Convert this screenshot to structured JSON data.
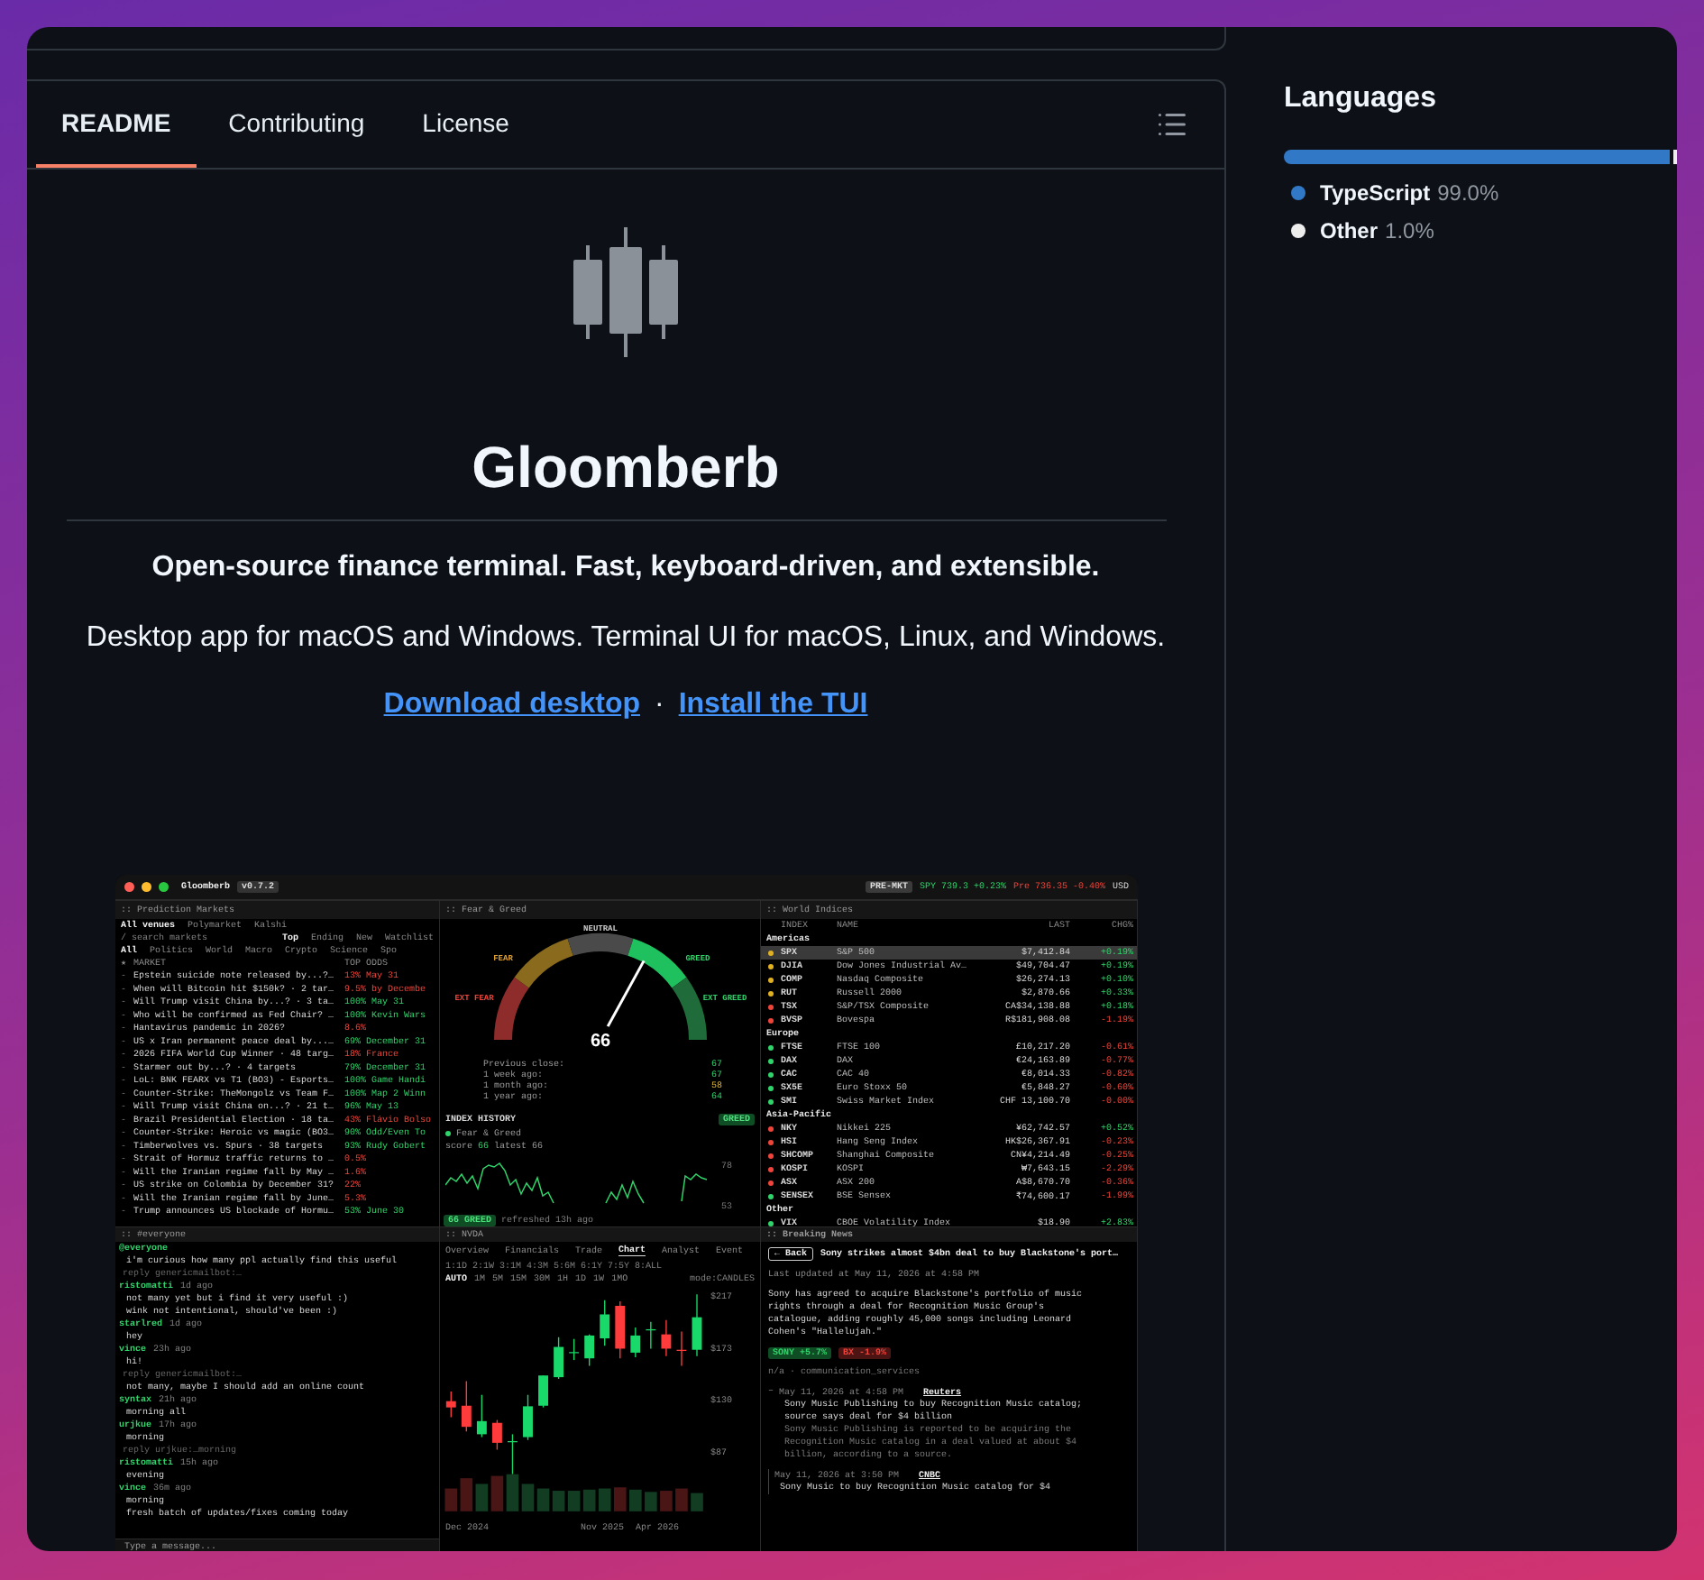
{
  "readme_tabs": [
    {
      "label": "README",
      "selected": true
    },
    {
      "label": "Contributing",
      "selected": false
    },
    {
      "label": "License",
      "selected": false
    }
  ],
  "readme": {
    "title": "Gloomberb",
    "tagline": "Open-source finance terminal. Fast, keyboard-driven, and extensible.",
    "description": "Desktop app for macOS and Windows. Terminal UI for macOS, Linux, and Windows.",
    "links": [
      "Download desktop",
      "Install the TUI"
    ],
    "link_separator": "·"
  },
  "app_screenshot": {
    "title": "Gloomberb",
    "version": "v0.7.2",
    "session": "PRE-MKT",
    "quotes": [
      {
        "text": "SPY 739.3 +0.23%",
        "rising": true
      },
      {
        "text": "Pre 736.35 -0.40%",
        "rising": false
      }
    ],
    "currency": "USD",
    "prediction_markets": {
      "title": ":: Prediction Markets",
      "venues": [
        {
          "label": "All venues",
          "selected": true
        },
        {
          "label": "Polymarket",
          "selected": false
        },
        {
          "label": "Kalshi",
          "selected": false
        }
      ],
      "search_placeholder": "/ search markets",
      "sorts": [
        {
          "label": "Top",
          "selected": true
        },
        {
          "label": "Ending",
          "selected": false
        },
        {
          "label": "New",
          "selected": false
        },
        {
          "label": "Watchlist",
          "selected": false
        }
      ],
      "categories": [
        {
          "label": "All",
          "selected": true
        },
        {
          "label": "Politics",
          "selected": false
        },
        {
          "label": "World",
          "selected": false
        },
        {
          "label": "Macro",
          "selected": false
        },
        {
          "label": "Crypto",
          "selected": false
        },
        {
          "label": "Science",
          "selected": false
        },
        {
          "label": "Spo",
          "selected": false
        }
      ],
      "columns": [
        "★",
        "MARKET",
        "TOP ODDS"
      ],
      "rows": [
        {
          "watch_mark": "-",
          "market": "Epstein suicide note released by...?…",
          "odds": "13% May 31",
          "rising": false
        },
        {
          "watch_mark": "-",
          "market": "When will Bitcoin hit $150k? · 2 tar…",
          "odds": "9.5% by Decembe",
          "rising": false
        },
        {
          "watch_mark": "-",
          "market": "Will Trump visit China by...? · 3 ta…",
          "odds": "100% May 31",
          "rising": true
        },
        {
          "watch_mark": "-",
          "market": "Who will be confirmed as Fed Chair? …",
          "odds": "100% Kevin Wars",
          "rising": true
        },
        {
          "watch_mark": "-",
          "market": "Hantavirus pandemic in 2026?",
          "odds": "8.6%",
          "rising": false
        },
        {
          "watch_mark": "-",
          "market": "US x Iran permanent peace deal by...…",
          "odds": "69% December 31",
          "rising": true
        },
        {
          "watch_mark": "-",
          "market": "2026 FIFA World Cup Winner · 48 targ…",
          "odds": "18% France",
          "rising": false
        },
        {
          "watch_mark": "-",
          "market": "Starmer out by...? · 4 targets",
          "odds": "79% December 31",
          "rising": true
        },
        {
          "watch_mark": "-",
          "market": "LoL: BNK FEARX vs T1 (BO3) - Esports…",
          "odds": "100% Game Handi",
          "rising": true
        },
        {
          "watch_mark": "-",
          "market": "Counter-Strike: TheMongolz vs Team F…",
          "odds": "100% Map 2 Winn",
          "rising": true
        },
        {
          "watch_mark": "-",
          "market": "Will Trump visit China on...? · 21 t…",
          "odds": "96% May 13",
          "rising": true
        },
        {
          "watch_mark": "-",
          "market": "Brazil Presidential Election · 18 ta…",
          "odds": "43% Flávio Bolso",
          "rising": false
        },
        {
          "watch_mark": "-",
          "market": "Counter-Strike: Heroic vs magic (BO3…",
          "odds": "90% Odd/Even To",
          "rising": true
        },
        {
          "watch_mark": "-",
          "market": "Timberwolves vs. Spurs · 38 targets",
          "odds": "93% Rudy Gobert",
          "rising": true
        },
        {
          "watch_mark": "-",
          "market": "Strait of Hormuz traffic returns to …",
          "odds": "0.5%",
          "rising": false
        },
        {
          "watch_mark": "-",
          "market": "Will the Iranian regime fall by May …",
          "odds": "1.6%",
          "rising": false
        },
        {
          "watch_mark": "-",
          "market": "US strike on Colombia by December 31?",
          "odds": "22%",
          "rising": false
        },
        {
          "watch_mark": "-",
          "market": "Will the Iranian regime fall by June…",
          "odds": "5.3%",
          "rising": false
        },
        {
          "watch_mark": "-",
          "market": "Trump announces US blockade of Hormu…",
          "odds": "53% June 30",
          "rising": true
        }
      ]
    },
    "fear_greed": {
      "title": ":: Fear & Greed",
      "zones": [
        "EXT FEAR",
        "FEAR",
        "NEUTRAL",
        "GREED",
        "EXT GREED"
      ],
      "score": "66",
      "stats": [
        {
          "label": "Previous close:",
          "value": "67",
          "kind": "greed"
        },
        {
          "label": "1 week ago:",
          "value": "67",
          "kind": "greed"
        },
        {
          "label": "1 month ago:",
          "value": "58",
          "kind": "neutral"
        },
        {
          "label": "1 year ago:",
          "value": "64",
          "kind": "greed"
        }
      ],
      "history_title": "INDEX HISTORY",
      "rating": "GREED",
      "legend": "Fear & Greed",
      "score_label": "score",
      "score_value": "66",
      "latest": "latest 66",
      "axis": [
        "78",
        "53"
      ],
      "status": "66 GREED",
      "refreshed": "refreshed 13h ago"
    },
    "world_indices": {
      "title": ":: World Indices",
      "columns": [
        "INDEX",
        "NAME",
        "LAST",
        "CHG%"
      ],
      "groups": [
        {
          "name": "Americas",
          "rows": [
            {
              "symbol": "SPX",
              "name": "S&P 500",
              "last": "$7,412.84",
              "change": "+0.19%",
              "rising": true,
              "color": "#e0b020",
              "selected": true
            },
            {
              "symbol": "DJIA",
              "name": "Dow Jones Industrial Av…",
              "last": "$49,704.47",
              "change": "+0.19%",
              "rising": true,
              "color": "#e0b020",
              "selected": false
            },
            {
              "symbol": "COMP",
              "name": "Nasdaq Composite",
              "last": "$26,274.13",
              "change": "+0.10%",
              "rising": true,
              "color": "#e0b020",
              "selected": false
            },
            {
              "symbol": "RUT",
              "name": "Russell 2000",
              "last": "$2,870.66",
              "change": "+0.33%",
              "rising": true,
              "color": "#e0b020",
              "selected": false
            },
            {
              "symbol": "TSX",
              "name": "S&P/TSX Composite",
              "last": "CA$34,138.88",
              "change": "+0.18%",
              "rising": true,
              "color": "#f0443a",
              "selected": false
            },
            {
              "symbol": "BVSP",
              "name": "Bovespa",
              "last": "R$181,908.08",
              "change": "-1.19%",
              "rising": false,
              "color": "#f0443a",
              "selected": false
            }
          ]
        },
        {
          "name": "Europe",
          "rows": [
            {
              "symbol": "FTSE",
              "name": "FTSE 100",
              "last": "£10,217.20",
              "change": "-0.61%",
              "rising": false,
              "color": "#2fd46a",
              "selected": false
            },
            {
              "symbol": "DAX",
              "name": "DAX",
              "last": "€24,163.89",
              "change": "-0.77%",
              "rising": false,
              "color": "#2fd46a",
              "selected": false
            },
            {
              "symbol": "CAC",
              "name": "CAC 40",
              "last": "€8,014.33",
              "change": "-0.82%",
              "rising": false,
              "color": "#2fd46a",
              "selected": false
            },
            {
              "symbol": "SX5E",
              "name": "Euro Stoxx 50",
              "last": "€5,848.27",
              "change": "-0.60%",
              "rising": false,
              "color": "#2fd46a",
              "selected": false
            },
            {
              "symbol": "SMI",
              "name": "Swiss Market Index",
              "last": "CHF 13,100.70",
              "change": "-0.00%",
              "rising": false,
              "color": "#2fd46a",
              "selected": false
            }
          ]
        },
        {
          "name": "Asia-Pacific",
          "rows": [
            {
              "symbol": "NKY",
              "name": "Nikkei 225",
              "last": "¥62,742.57",
              "change": "+0.52%",
              "rising": true,
              "color": "#f0443a",
              "selected": false
            },
            {
              "symbol": "HSI",
              "name": "Hang Seng Index",
              "last": "HK$26,367.91",
              "change": "-0.23%",
              "rising": false,
              "color": "#f0443a",
              "selected": false
            },
            {
              "symbol": "SHCOMP",
              "name": "Shanghai Composite",
              "last": "CN¥4,214.49",
              "change": "-0.25%",
              "rising": false,
              "color": "#f0443a",
              "selected": false
            },
            {
              "symbol": "KOSPI",
              "name": "KOSPI",
              "last": "₩7,643.15",
              "change": "-2.29%",
              "rising": false,
              "color": "#f0443a",
              "selected": false
            },
            {
              "symbol": "ASX",
              "name": "ASX 200",
              "last": "A$8,670.70",
              "change": "-0.36%",
              "rising": false,
              "color": "#f0443a",
              "selected": false
            },
            {
              "symbol": "SENSEX",
              "name": "BSE Sensex",
              "last": "₹74,600.17",
              "change": "-1.99%",
              "rising": false,
              "color": "#2fd46a",
              "selected": false
            }
          ]
        },
        {
          "name": "Other",
          "rows": [
            {
              "symbol": "VIX",
              "name": "CBOE Volatility Index",
              "last": "$18.90",
              "change": "+2.83%",
              "rising": true,
              "color": "#2fd46a",
              "selected": false
            }
          ]
        }
      ]
    },
    "chat": {
      "title": ":: #everyone",
      "messages": [
        {
          "kind": "author",
          "user": "@everyone"
        },
        {
          "kind": "line",
          "text": "i'm curious how many ppl actually find this useful"
        },
        {
          "kind": "reply",
          "text": "reply genericmailbot:…"
        },
        {
          "kind": "author",
          "user": "ristomatti",
          "time": "1d ago"
        },
        {
          "kind": "line",
          "text": "not many yet but i find it very useful :)"
        },
        {
          "kind": "line",
          "text": "wink not intentional, should've been :)"
        },
        {
          "kind": "author",
          "user": "starlred",
          "time": "1d ago"
        },
        {
          "kind": "line",
          "text": "hey"
        },
        {
          "kind": "author",
          "user": "vince",
          "time": "23h ago"
        },
        {
          "kind": "line",
          "text": "hi!"
        },
        {
          "kind": "reply",
          "text": "reply genericmailbot:…"
        },
        {
          "kind": "line",
          "text": "not many, maybe I should add an online count"
        },
        {
          "kind": "author",
          "user": "syntax",
          "time": "21h ago"
        },
        {
          "kind": "line",
          "text": "morning all"
        },
        {
          "kind": "author",
          "user": "urjkue",
          "time": "17h ago"
        },
        {
          "kind": "line",
          "text": "morning"
        },
        {
          "kind": "reply",
          "text": "reply urjkue:…morning"
        },
        {
          "kind": "author",
          "user": "ristomatti",
          "time": "15h ago"
        },
        {
          "kind": "line",
          "text": "evening"
        },
        {
          "kind": "author",
          "user": "vince",
          "time": "36m ago"
        },
        {
          "kind": "line",
          "text": "morning"
        },
        {
          "kind": "line",
          "text": "fresh batch of updates/fixes coming today"
        }
      ],
      "input_placeholder": "Type a message..."
    },
    "stock_chart": {
      "title": ":: NVDA",
      "tabs": [
        {
          "label": "Overview",
          "selected": false
        },
        {
          "label": "Financials",
          "selected": false
        },
        {
          "label": "Trade",
          "selected": false
        },
        {
          "label": "Chart",
          "selected": true
        },
        {
          "label": "Analyst",
          "selected": false
        },
        {
          "label": "Event",
          "selected": false
        }
      ],
      "ranges": [
        "1:1D",
        "2:1W",
        "3:1M",
        "4:3M",
        "5:6M",
        "6:1Y",
        "7:5Y",
        "8:ALL"
      ],
      "intervals": [
        {
          "label": "AUTO",
          "selected": true
        },
        {
          "label": "1M",
          "selected": false
        },
        {
          "label": "5M",
          "selected": false
        },
        {
          "label": "15M",
          "selected": false
        },
        {
          "label": "30M",
          "selected": false
        },
        {
          "label": "1H",
          "selected": false
        },
        {
          "label": "1D",
          "selected": false
        },
        {
          "label": "1W",
          "selected": false
        },
        {
          "label": "1MO",
          "selected": false
        }
      ],
      "mode": "mode:CANDLES",
      "price_labels": [
        "$217",
        "$173",
        "$130",
        "$87"
      ],
      "date_labels": [
        "Dec 2024",
        "Nov 2025",
        "Apr 2026"
      ]
    },
    "news": {
      "title": ":: Breaking News",
      "back": "← Back",
      "headline": "Sony strikes almost $4bn deal to buy Blackstone's port…",
      "updated": "Last updated at May 11, 2026 at 4:58 PM",
      "body": "Sony has agreed to acquire Blackstone's portfolio of music rights through a deal for Recognition Music Group's catalogue, adding roughly 45,000 songs including Leonard Cohen's \"Hallelujah.\"",
      "tickers": [
        {
          "text": "SONY +5.7%",
          "rising": true
        },
        {
          "text": "BX -1.9%",
          "rising": false
        }
      ],
      "sector": "n/a · communication_services",
      "items": [
        {
          "marker": "–",
          "time": "May 11, 2026 at 4:58 PM",
          "source": "Reuters",
          "title": "Sony Music Publishing to buy Recognition Music catalog; source says deal for $4 billion",
          "summary": "Sony Music Publishing is reported to be acquiring the Recognition Music catalog in a deal valued at about $4 billion, according to a source."
        },
        {
          "time": "May 11, 2026 at 3:50 PM",
          "source": "CNBC",
          "title": "Sony Music to buy Recognition Music catalog for $4"
        }
      ]
    }
  },
  "languages": {
    "title": "Languages",
    "items": [
      {
        "name": "TypeScript",
        "percent": "99.0%",
        "color": "#3178c6",
        "level": 0.99
      },
      {
        "name": "Other",
        "percent": "1.0%",
        "color": "#ededed",
        "level": 0.01
      }
    ]
  }
}
